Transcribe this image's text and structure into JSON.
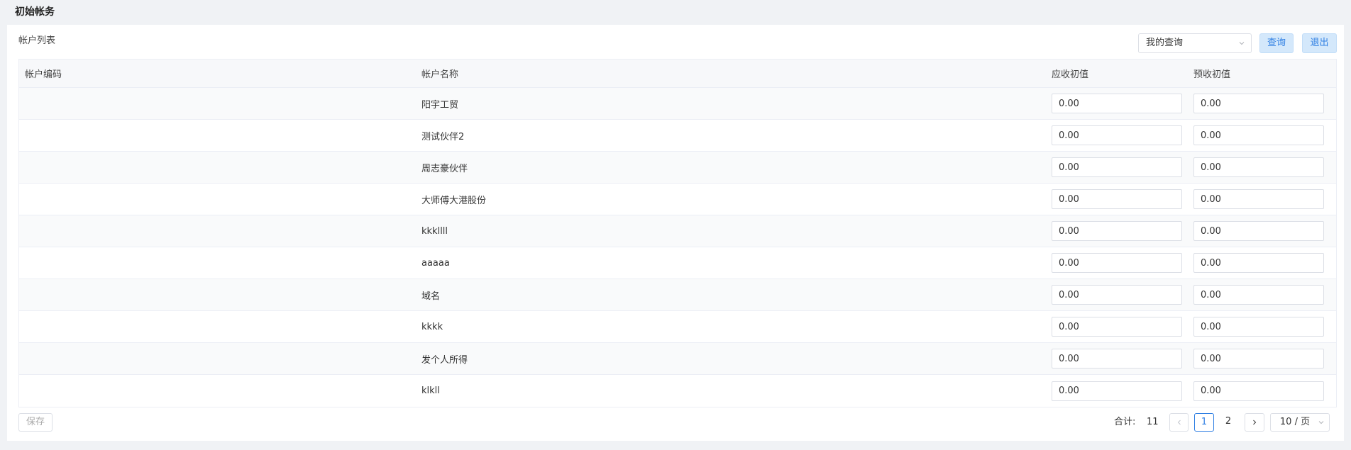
{
  "page": {
    "title": "初始帐务"
  },
  "toolbar": {
    "list_title": "帐户列表",
    "query_select_value": "我的查询",
    "query_label": "查询",
    "exit_label": "退出"
  },
  "table": {
    "headers": {
      "code": "帐户编码",
      "name": "帐户名称",
      "receivable": "应收初值",
      "prepaid": "预收初值"
    },
    "rows": [
      {
        "code": "",
        "name": "阳宇工贸",
        "receivable": "0.00",
        "prepaid": "0.00"
      },
      {
        "code": "",
        "name": "测试伙伴2",
        "receivable": "0.00",
        "prepaid": "0.00"
      },
      {
        "code": "",
        "name": "周志豪伙伴",
        "receivable": "0.00",
        "prepaid": "0.00"
      },
      {
        "code": "",
        "name": "大师傅大港股份",
        "receivable": "0.00",
        "prepaid": "0.00"
      },
      {
        "code": "",
        "name": "kkkllll",
        "receivable": "0.00",
        "prepaid": "0.00"
      },
      {
        "code": "",
        "name": "aaaaa",
        "receivable": "0.00",
        "prepaid": "0.00"
      },
      {
        "code": "",
        "name": "域名",
        "receivable": "0.00",
        "prepaid": "0.00"
      },
      {
        "code": "",
        "name": "kkkk",
        "receivable": "0.00",
        "prepaid": "0.00"
      },
      {
        "code": "",
        "name": "发个人所得",
        "receivable": "0.00",
        "prepaid": "0.00"
      },
      {
        "code": "",
        "name": "klkll",
        "receivable": "0.00",
        "prepaid": "0.00"
      }
    ]
  },
  "footer": {
    "save_label": "保存",
    "total_label": "合计:",
    "total_value": "11",
    "pages": [
      "1",
      "2"
    ],
    "current_page": "1",
    "page_size_label": "10 / 页"
  },
  "icons": {
    "select_chevron": "chevron-down-icon",
    "prev": "chevron-left-icon",
    "next": "chevron-right-icon"
  },
  "colors": {
    "accent": "#2f7fe3",
    "button_bg": "#d4e8fb"
  }
}
